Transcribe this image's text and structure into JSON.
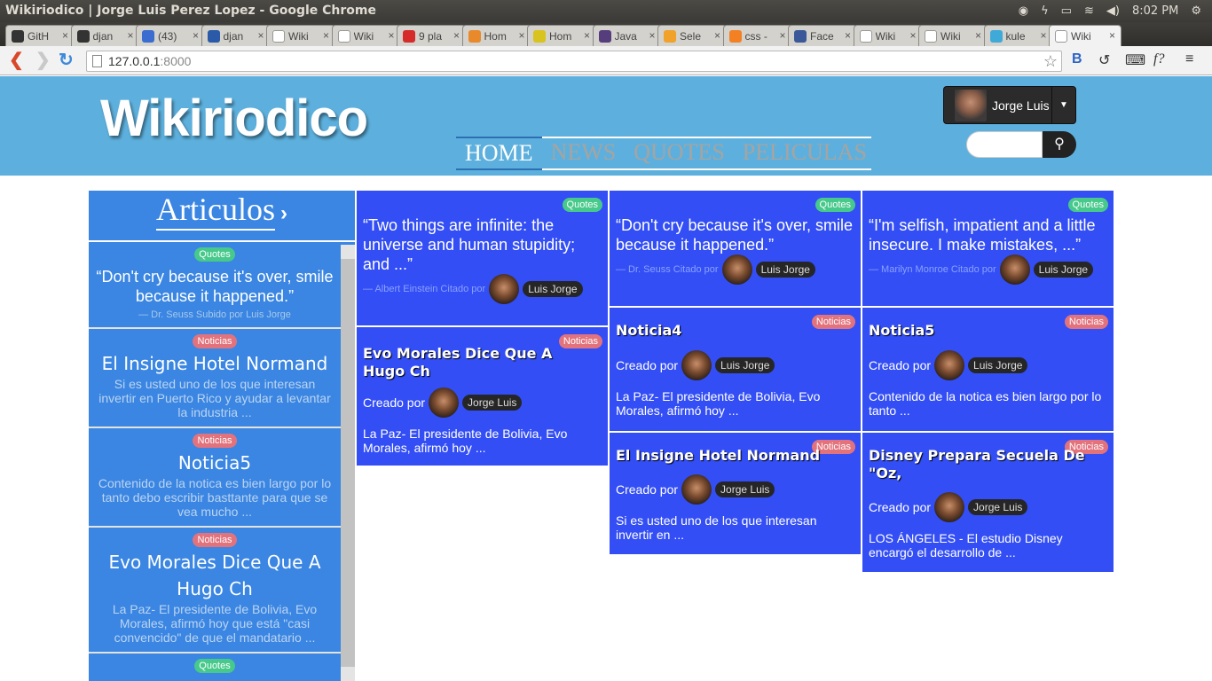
{
  "window_title": "Wikiriodico | Jorge Luis Perez Lopez - Google Chrome",
  "tray": {
    "time": "8:02 PM"
  },
  "tabs": [
    {
      "label": "GitH",
      "icon": "github-icon",
      "color": "#333333"
    },
    {
      "label": "djan",
      "icon": "github-icon",
      "color": "#333333"
    },
    {
      "label": "(43)",
      "icon": "chat-icon",
      "color": "#3b6ccf"
    },
    {
      "label": "djan",
      "icon": "tx-icon",
      "color": "#2b5aa8"
    },
    {
      "label": "Wiki",
      "icon": "page-icon",
      "color": "#ffffff"
    },
    {
      "label": "Wiki",
      "icon": "page-icon",
      "color": "#ffffff"
    },
    {
      "label": "9 pla",
      "icon": "tnw-icon",
      "color": "#d62b2b"
    },
    {
      "label": "Hom",
      "icon": "home-icon",
      "color": "#e8892c"
    },
    {
      "label": "Hom",
      "icon": "home-icon",
      "color": "#d8c31f"
    },
    {
      "label": "Java",
      "icon": "bootstrap-icon",
      "color": "#563d7c"
    },
    {
      "label": "Sele",
      "icon": "u-icon",
      "color": "#f0a22b"
    },
    {
      "label": "css -",
      "icon": "stackoverflow-icon",
      "color": "#f48024"
    },
    {
      "label": "Face",
      "icon": "facebook-icon",
      "color": "#3b5998"
    },
    {
      "label": "Wiki",
      "icon": "page-icon",
      "color": "#ffffff"
    },
    {
      "label": "Wiki",
      "icon": "page-icon",
      "color": "#ffffff"
    },
    {
      "label": "kule",
      "icon": "ku-icon",
      "color": "#3fa9d8"
    },
    {
      "label": "Wiki",
      "icon": "page-icon",
      "color": "#ffffff"
    }
  ],
  "address": {
    "host": "127.0.0.1",
    "port": ":8000"
  },
  "site": {
    "logo": "Wikiriodico",
    "nav": [
      "HOME",
      "NEWS",
      "QUOTES",
      "PELICULAS"
    ],
    "user": {
      "name": "Jorge Luis"
    },
    "colors": {
      "header": "#5db0dd",
      "card": "#334ef5",
      "sidebar": "#3a86e2",
      "quotes_badge": "#47c98b",
      "news_badge": "#e2737d"
    }
  },
  "sidebar": {
    "title": "Articulos",
    "items": [
      {
        "badge": "Quotes",
        "quote": "“Don't cry because it's over, smile because it happened.”",
        "cite": "— Dr. Seuss Subido por Luis Jorge"
      },
      {
        "badge": "Noticias",
        "heading": "El Insigne Hotel Normand",
        "text": "Si es usted uno de los que interesan invertir en Puerto Rico y ayudar a levantar la industria ..."
      },
      {
        "badge": "Noticias",
        "heading": "Noticia5",
        "text": "Contenido de la notica es bien largo por lo tanto debo escribir basttante para que se vea mucho ..."
      },
      {
        "badge": "Noticias",
        "heading": "Evo Morales Dice Que A Hugo Ch",
        "text": "La Paz- El presidente de Bolivia, Evo Morales, afirmó hoy que está \"casi convencido\" de que el mandatario ..."
      },
      {
        "badge": "Quotes"
      }
    ]
  },
  "cards": {
    "c1": {
      "badge": "Quotes",
      "quote": "“Two things are infinite: the universe and human stupidity; and ...”",
      "cite": "— Albert Einstein Citado por",
      "user": "Luis Jorge"
    },
    "c2": {
      "badge": "Noticias",
      "heading": "Evo Morales Dice Que A Hugo Ch",
      "by": "Creado por",
      "user": "Jorge Luis",
      "text": "La Paz- El presidente de Bolivia, Evo Morales, afirmó hoy ..."
    },
    "c3": {
      "badge": "Quotes",
      "quote": "“Don't cry because it's over, smile because it happened.”",
      "cite": "— Dr. Seuss Citado por",
      "user": "Luis Jorge"
    },
    "c4": {
      "badge": "Noticias",
      "heading": "Noticia4",
      "by": "Creado por",
      "user": "Luis Jorge",
      "text": "La Paz- El presidente de Bolivia, Evo Morales, afirmó hoy ..."
    },
    "c5": {
      "badge": "Noticias",
      "heading": "El Insigne Hotel Normand",
      "by": "Creado por",
      "user": "Jorge Luis",
      "text": "Si es usted uno de los que interesan invertir en ..."
    },
    "c6": {
      "badge": "Quotes",
      "quote": "“I'm selfish, impatient and a little insecure. I make mistakes, ...”",
      "cite": "— Marilyn Monroe Citado por",
      "user": "Luis Jorge"
    },
    "c7": {
      "badge": "Noticias",
      "heading": "Noticia5",
      "by": "Creado por",
      "user": "Luis Jorge",
      "text": "Contenido de la notica es bien largo por lo tanto ..."
    },
    "c8": {
      "badge": "Noticias",
      "heading": "Disney Prepara Secuela De \"Oz,",
      "by": "Creado por",
      "user": "Jorge Luis",
      "text": "LOS ÁNGELES - El estudio Disney encargó el desarrollo de ..."
    }
  }
}
